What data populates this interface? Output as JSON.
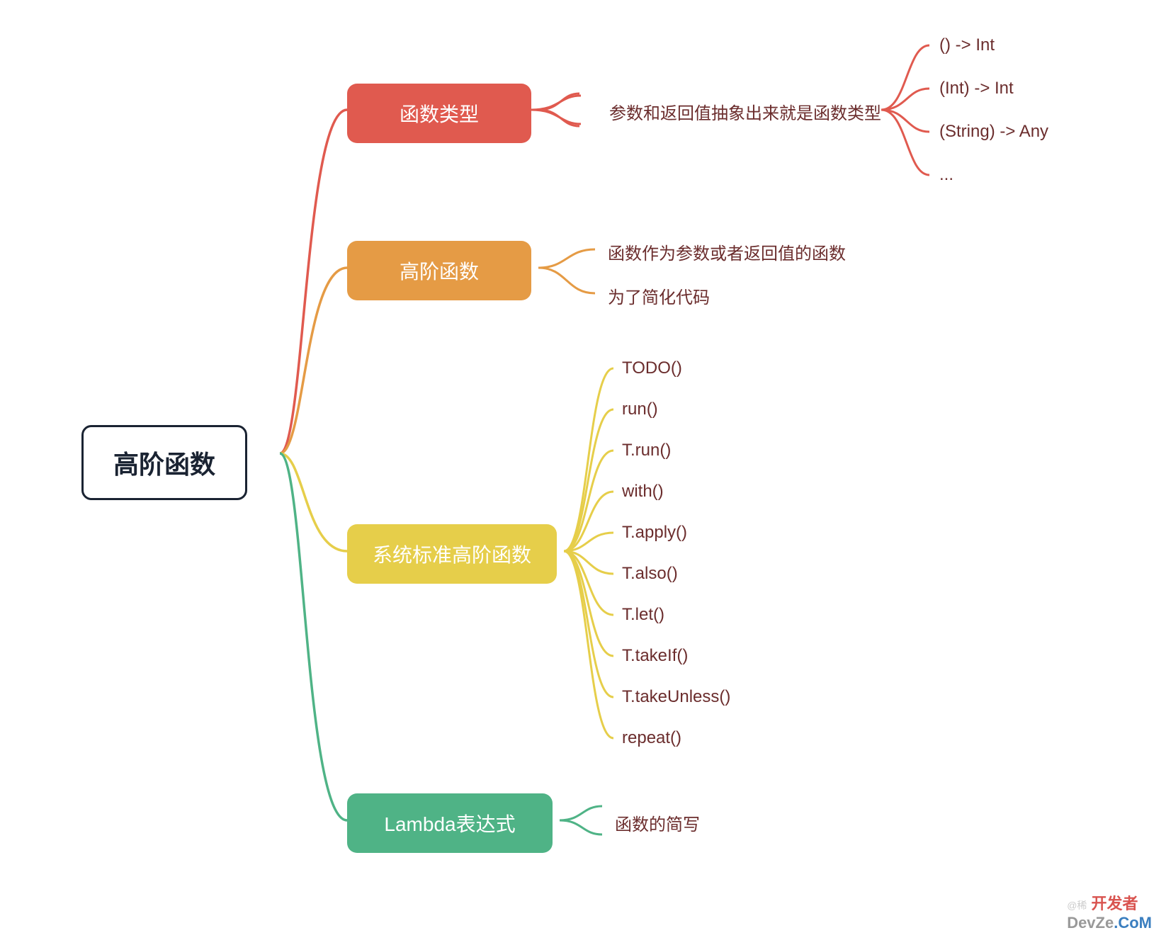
{
  "root": {
    "label": "高阶函数"
  },
  "branches": [
    {
      "id": "func-type",
      "label": "函数类型",
      "color": "#e05a4f",
      "desc": "参数和返回值抽象出来就是函数类型",
      "children": [
        "() -> Int",
        "(Int) -> Int",
        "(String) -> Any",
        "..."
      ]
    },
    {
      "id": "higher-order",
      "label": "高阶函数",
      "color": "#e59b45",
      "desc_items": [
        "函数作为参数或者返回值的函数",
        "为了简化代码"
      ]
    },
    {
      "id": "std-higher",
      "label": "系统标准高阶函数",
      "color": "#e6ce4a",
      "children": [
        "TODO()",
        "run()",
        "T.run()",
        "with()",
        "T.apply()",
        "T.also()",
        "T.let()",
        "T.takeIf()",
        "T.takeUnless()",
        "repeat()"
      ]
    },
    {
      "id": "lambda",
      "label": "Lambda表达式",
      "color": "#4fb386",
      "desc": "函数的简写"
    }
  ],
  "watermark": {
    "small": "@稀",
    "p1": "开发者",
    "p2": "DevZe",
    "p3": ".CoM"
  }
}
